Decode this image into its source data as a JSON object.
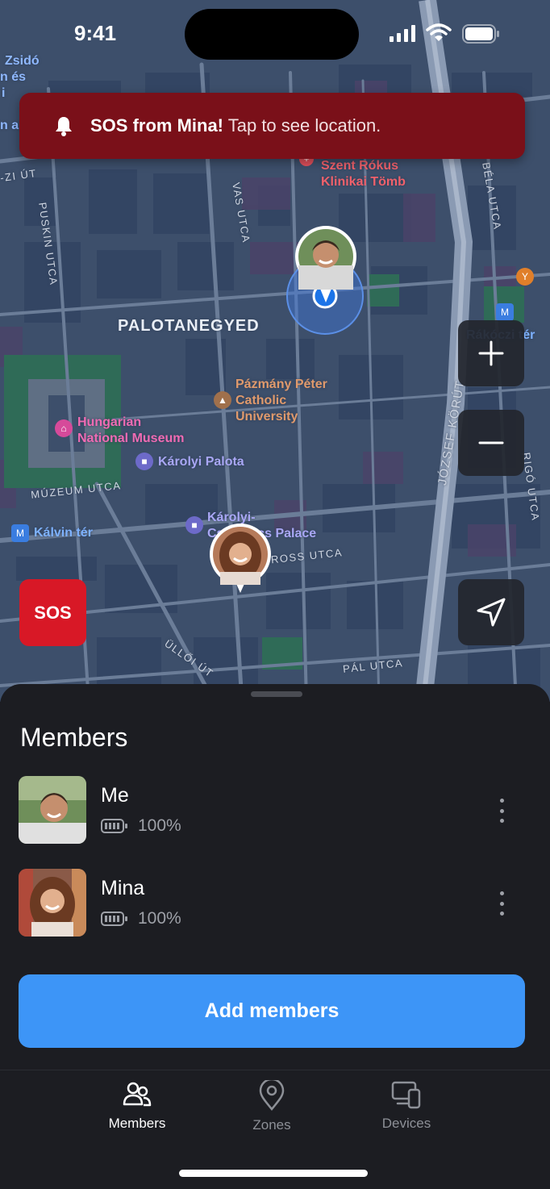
{
  "status_bar": {
    "time": "9:41"
  },
  "banner": {
    "bold": "SOS from Mina!",
    "text": " Tap to see location.",
    "color": "#7a1019"
  },
  "map": {
    "district": "PALOTANEGYED",
    "streets": [
      "PUSKIN UTCA",
      "VAS UTCA",
      "JÓZSEF KÖRÚT",
      "MÚZEUM UTCA",
      "ÜLLŐI ÚT",
      "PÁL UTCA",
      "BÉLA UTCA",
      "RIGÓ UTCA",
      "-ROSS UTCA",
      "-ZI ÚT"
    ],
    "pois": {
      "szent_rokus_1": "Szent Rókus",
      "szent_rokus_2": "Klinikai Tömb",
      "pazmany_1": "Pázmány Péter",
      "pazmany_2": "Catholic",
      "pazmany_3": "University",
      "museum_1": "Hungarian",
      "museum_2": "National Museum",
      "karolyi_palota": "Károlyi Palota",
      "karolyi_palace_1": "Károlyi-",
      "karolyi_palace_2": "Csekonics Palace",
      "kalvin": "Kálvin tér",
      "rakoczi": "Rákóczi tér",
      "zsido_1": "Zsidó",
      "zsido_2": "n és",
      "zsido_3": "i",
      "zsido_4": "n a"
    }
  },
  "controls": {
    "sos_label": "SOS"
  },
  "sheet": {
    "title": "Members",
    "members": [
      {
        "name": "Me",
        "battery": "100%"
      },
      {
        "name": "Mina",
        "battery": "100%"
      }
    ],
    "add_button": "Add members"
  },
  "tabs": [
    {
      "label": "Members",
      "icon": "people-icon",
      "active": true
    },
    {
      "label": "Zones",
      "icon": "location-pin-icon",
      "active": false
    },
    {
      "label": "Devices",
      "icon": "devices-icon",
      "active": false
    }
  ],
  "colors": {
    "accent": "#3d95f7",
    "sos": "#d81826",
    "map_base": "#3d4f6b"
  }
}
